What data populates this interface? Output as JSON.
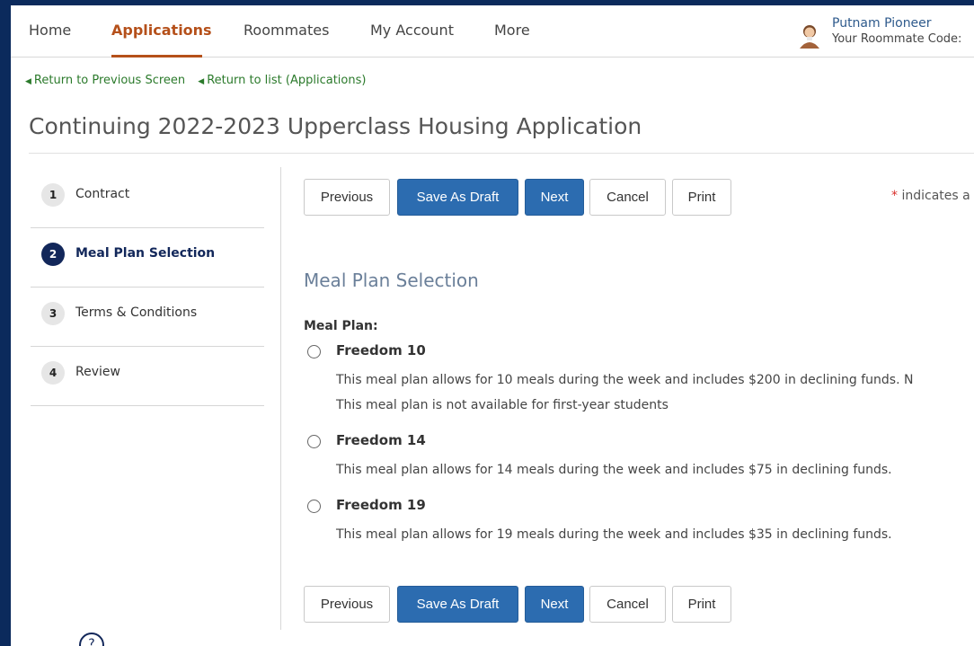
{
  "nav": {
    "items": [
      {
        "label": "Home"
      },
      {
        "label": "Applications"
      },
      {
        "label": "Roommates"
      },
      {
        "label": "My Account"
      },
      {
        "label": "More"
      }
    ],
    "active": "Applications",
    "user_name": "Putnam Pioneer",
    "user_code": "Your Roommate Code:"
  },
  "breadcrumbs": {
    "back": "Return to Previous Screen",
    "list": "Return to list (Applications)"
  },
  "page_title": "Continuing 2022-2023 Upperclass Housing Application",
  "steps": [
    {
      "num": "1",
      "label": "Contract"
    },
    {
      "num": "2",
      "label": "Meal Plan Selection"
    },
    {
      "num": "3",
      "label": "Terms & Conditions"
    },
    {
      "num": "4",
      "label": "Review"
    }
  ],
  "active_step": 2,
  "buttons": {
    "previous": "Previous",
    "save_draft": "Save As Draft",
    "next": "Next",
    "cancel": "Cancel",
    "print": "Print"
  },
  "required_note": {
    "star": "*",
    "text": "indicates a"
  },
  "section_title": "Meal Plan Selection",
  "field_label": "Meal Plan:",
  "options": [
    {
      "name": "Freedom 10",
      "desc_line1": "This meal plan allows for 10 meals during the week and includes $200 in declining funds. N",
      "desc_line2": "This meal plan is not available for first-year students"
    },
    {
      "name": "Freedom 14",
      "desc_line1": "This meal plan allows for 14 meals during the week and includes $75 in declining funds."
    },
    {
      "name": "Freedom 19",
      "desc_line1": "This meal plan allows for 19 meals during the week and includes $35 in declining funds."
    }
  ],
  "colors": {
    "frame_bg": "#0b2a5c",
    "active_tab": "#b5501a",
    "link_green": "#2b7a2b",
    "primary_button": "#2c6cb0",
    "active_step": "#12275a"
  },
  "icons": {
    "avatar": "user-avatar-icon",
    "breadcrumb_arrow": "triangle-left-icon",
    "help": "help-icon"
  }
}
